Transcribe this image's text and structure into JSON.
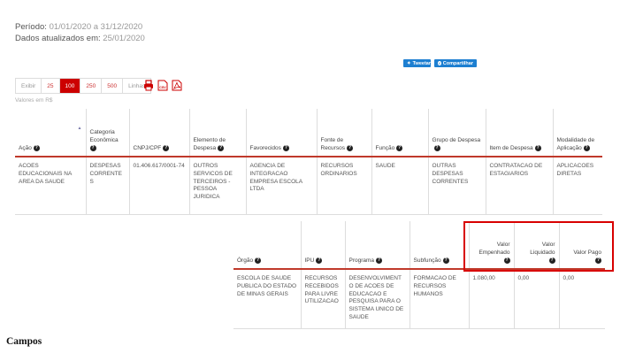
{
  "period": {
    "label": "Período:",
    "value": "01/01/2020 a 31/12/2020"
  },
  "updated": {
    "label": "Dados atualizados em:",
    "value": "25/01/2020"
  },
  "social": {
    "tweet": "Tweetar",
    "share": "Compartilhar"
  },
  "pager": {
    "show": "Exibir",
    "options": [
      "25",
      "100",
      "250",
      "500"
    ],
    "lines": "Linhas"
  },
  "export": {
    "print": "print-icon",
    "csv": "CSV",
    "pdf": "pdf-icon"
  },
  "note": "Valores em R$",
  "table1": {
    "headers": [
      "Ação",
      "Categoria Econômica",
      "CNPJ/CPF",
      "Elemento de Despesa",
      "Favorecidos",
      "Fonte de Recursos",
      "Função",
      "Grupo de Despesa",
      "Item de Despesa",
      "Modalidade de Aplicação"
    ],
    "row": [
      "ACOES EDUCACIONAIS NA AREA DA SAUDE",
      "DESPESAS CORRENTES",
      "01.406.617/0001-74",
      "OUTROS SERVICOS DE TERCEIROS - PESSOA JURIDICA",
      "AGENCIA DE INTEGRACAO EMPRESA ESCOLA LTDA",
      "RECURSOS ORDINARIOS",
      "SAUDE",
      "OUTRAS DESPESAS CORRENTES",
      "CONTRATACAO DE ESTAGIARIOS",
      "APLICACOES DIRETAS"
    ]
  },
  "table2": {
    "headers": [
      "Órgão",
      "IPU",
      "Programa",
      "Subfunção",
      "Valor Empenhado",
      "Valor Liquidado",
      "Valor Pago"
    ],
    "row": [
      "ESCOLA DE SAUDE PUBLICA DO ESTADO DE MINAS GERAIS",
      "RECURSOS RECEBIDOS PARA LIVRE UTILIZACAO",
      "DESENVOLVIMENTO DE ACOES DE EDUCACAO E PESQUISA PARA O SISTEMA UNICO DE SAUDE",
      "FORMACAO DE RECURSOS HUMANOS",
      "1.080,00",
      "0,00",
      "0,00"
    ]
  },
  "caption": "Campos",
  "colors": {
    "accent": "#c0392b",
    "highlight": "#d80000",
    "social": "#1d7fd1"
  }
}
